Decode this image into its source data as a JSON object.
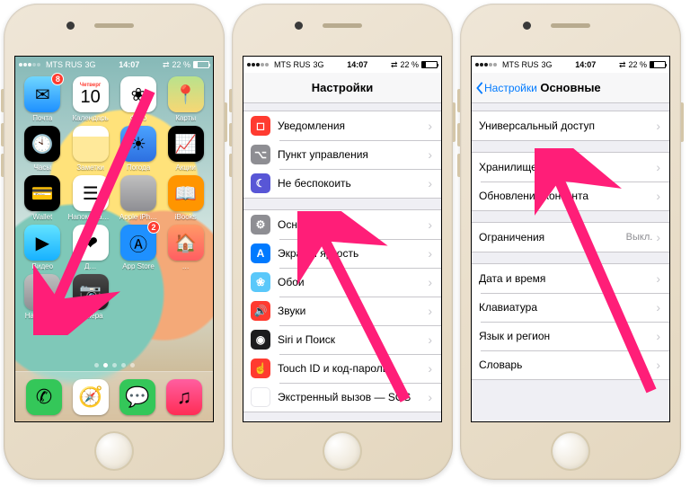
{
  "status": {
    "carrier": "MTS RUS",
    "network": "3G",
    "time": "14:07",
    "battery_pct": "22 %"
  },
  "home": {
    "calendar": {
      "weekday": "Четверг",
      "day": "10"
    },
    "apps": [
      {
        "name": "Почта",
        "color": "linear-gradient(#6fd6ff,#1e90ff)",
        "glyph": "✉",
        "badge": "8"
      },
      {
        "name": "Календарь",
        "calendar": true
      },
      {
        "name": "Фото",
        "color": "#fff",
        "glyph": "❀"
      },
      {
        "name": "Карты",
        "color": "linear-gradient(#b9e28c,#f7d774)",
        "glyph": "📍"
      },
      {
        "name": "Часы",
        "color": "#000",
        "glyph": "🕙"
      },
      {
        "name": "Заметки",
        "color": "linear-gradient(#fff 30%,#ffe99a 30%)",
        "glyph": ""
      },
      {
        "name": "Погода",
        "color": "linear-gradient(#4aa3ff,#2d6fe0)",
        "glyph": "☀"
      },
      {
        "name": "Акции",
        "color": "#000",
        "glyph": "📈"
      },
      {
        "name": "Wallet",
        "color": "#000",
        "glyph": "💳"
      },
      {
        "name": "Напоминания",
        "color": "#fff",
        "glyph": "☰"
      },
      {
        "name": "Apple iPh…",
        "color": "linear-gradient(#c0c0c0,#8e8e93)",
        "glyph": ""
      },
      {
        "name": "iBooks",
        "color": "#ff9500",
        "glyph": "📖"
      },
      {
        "name": "Видео",
        "color": "linear-gradient(#63e3ff,#17b1ff)",
        "glyph": "▶"
      },
      {
        "name": "Д…",
        "color": "#fff",
        "glyph": "❤"
      },
      {
        "name": "App Store",
        "color": "#1e90ff",
        "glyph": "Ⓐ",
        "badge": "2"
      },
      {
        "name": "…",
        "color": "linear-gradient(#ff9966,#ff5e62)",
        "glyph": "🏠"
      },
      {
        "name": "Настройки",
        "color": "linear-gradient(#bfbfbf,#8e8e93)",
        "glyph": "⚙"
      },
      {
        "name": "Камера",
        "color": "linear-gradient(#4a4a4a,#1c1c1e)",
        "glyph": "📷"
      }
    ],
    "dock": [
      {
        "name": "Телефон",
        "color": "#34c759",
        "glyph": "✆"
      },
      {
        "name": "Safari",
        "color": "#fff",
        "glyph": "🧭"
      },
      {
        "name": "Сообщения",
        "color": "#34c759",
        "glyph": "💬"
      },
      {
        "name": "Музыка",
        "color": "linear-gradient(#ff5ea0,#ff2d55)",
        "glyph": "♫"
      }
    ]
  },
  "settings": {
    "title": "Настройки",
    "rows": [
      {
        "icon": "i-red",
        "glyph": "◻",
        "label": "Уведомления"
      },
      {
        "icon": "i-grey",
        "glyph": "⌥",
        "label": "Пункт управления"
      },
      {
        "icon": "i-purple",
        "glyph": "☾",
        "label": "Не беспокоить"
      }
    ],
    "rows2": [
      {
        "icon": "i-grey",
        "glyph": "⚙",
        "label": "Основные"
      },
      {
        "icon": "i-blue",
        "glyph": "A",
        "label": "Экран и яркость"
      },
      {
        "icon": "i-cyan",
        "glyph": "❀",
        "label": "Обои"
      },
      {
        "icon": "i-red",
        "glyph": "🔊",
        "label": "Звуки"
      },
      {
        "icon": "i-dark",
        "glyph": "◉",
        "label": "Siri и Поиск"
      },
      {
        "icon": "i-red",
        "glyph": "☝",
        "label": "Touch ID и код-пароль"
      },
      {
        "icon": "i-white",
        "glyph": "SOS",
        "label": "Экстренный вызов — SOS"
      }
    ]
  },
  "general": {
    "back": "Настройки",
    "title": "Основные",
    "g1": [
      {
        "label": "Универсальный доступ"
      }
    ],
    "g2": [
      {
        "label": "Хранилище iPhone"
      },
      {
        "label": "Обновление контента"
      }
    ],
    "g3": [
      {
        "label": "Ограничения",
        "value": "Выкл."
      }
    ],
    "g4": [
      {
        "label": "Дата и время"
      },
      {
        "label": "Клавиатура"
      },
      {
        "label": "Язык и регион"
      },
      {
        "label": "Словарь"
      }
    ]
  }
}
